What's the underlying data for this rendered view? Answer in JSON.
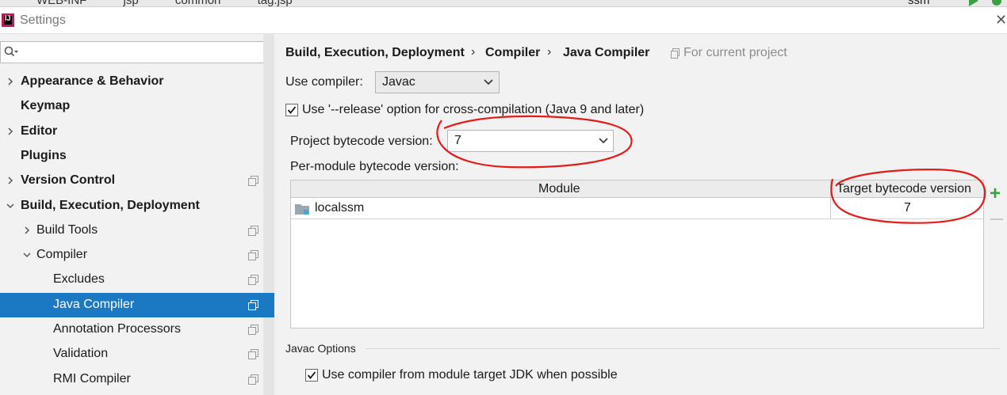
{
  "topbar": {
    "crumbs": [
      "WEB-INF",
      "jsp",
      "common",
      "tag.jsp"
    ],
    "run_config": "ssm"
  },
  "window": {
    "title": "Settings"
  },
  "search": {
    "placeholder": "",
    "value": ""
  },
  "tree": [
    {
      "label": "Appearance & Behavior",
      "level": 0,
      "bold": true,
      "arrow": "right",
      "copy": false,
      "selected": false
    },
    {
      "label": "Keymap",
      "level": 0,
      "bold": true,
      "arrow": "none",
      "copy": false,
      "selected": false
    },
    {
      "label": "Editor",
      "level": 0,
      "bold": true,
      "arrow": "right",
      "copy": false,
      "selected": false
    },
    {
      "label": "Plugins",
      "level": 0,
      "bold": true,
      "arrow": "none",
      "copy": false,
      "selected": false
    },
    {
      "label": "Version Control",
      "level": 0,
      "bold": true,
      "arrow": "right",
      "copy": true,
      "selected": false
    },
    {
      "label": "Build, Execution, Deployment",
      "level": 0,
      "bold": true,
      "arrow": "down",
      "copy": false,
      "selected": false
    },
    {
      "label": "Build Tools",
      "level": 1,
      "bold": false,
      "arrow": "right",
      "copy": true,
      "selected": false
    },
    {
      "label": "Compiler",
      "level": 1,
      "bold": false,
      "arrow": "down",
      "copy": true,
      "selected": false
    },
    {
      "label": "Excludes",
      "level": 2,
      "bold": false,
      "arrow": "none",
      "copy": true,
      "selected": false
    },
    {
      "label": "Java Compiler",
      "level": 2,
      "bold": false,
      "arrow": "none",
      "copy": true,
      "selected": true
    },
    {
      "label": "Annotation Processors",
      "level": 2,
      "bold": false,
      "arrow": "none",
      "copy": true,
      "selected": false
    },
    {
      "label": "Validation",
      "level": 2,
      "bold": false,
      "arrow": "none",
      "copy": true,
      "selected": false
    },
    {
      "label": "RMI Compiler",
      "level": 2,
      "bold": false,
      "arrow": "none",
      "copy": true,
      "selected": false
    }
  ],
  "breadcrumb": {
    "items": [
      "Build, Execution, Deployment",
      "Compiler",
      "Java Compiler"
    ],
    "separator": "›",
    "scope": "For current project"
  },
  "form": {
    "use_compiler_label": "Use compiler:",
    "use_compiler_value": "Javac",
    "release_option_label": "Use '--release' option for cross-compilation (Java 9 and later)",
    "release_option_checked": true,
    "project_bytecode_label": "Project bytecode version:",
    "project_bytecode_value": "7",
    "per_module_label": "Per-module bytecode version:"
  },
  "module_table": {
    "columns": [
      "Module",
      "Target bytecode version"
    ],
    "rows": [
      {
        "module": "localssm",
        "target": "7"
      }
    ]
  },
  "javac_options": {
    "section_title": "Javac Options",
    "module_jdk_label": "Use compiler from module target JDK when possible",
    "module_jdk_checked": true
  },
  "colors": {
    "selection": "#1b78c2",
    "annotation": "#e31b1b",
    "add": "#3aa043"
  }
}
